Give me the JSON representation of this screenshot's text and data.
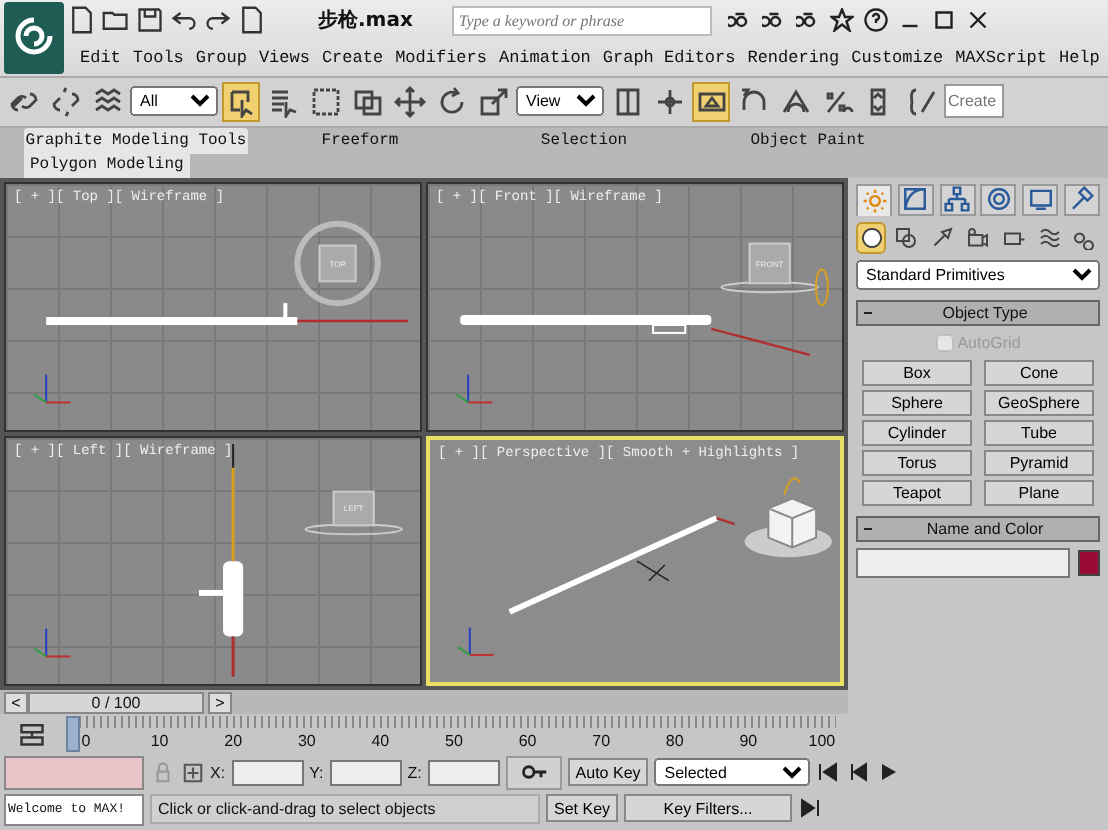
{
  "app": {
    "title": "步枪.max",
    "search": {
      "placeholder": "Type a keyword or phrase"
    }
  },
  "menu": [
    "Edit",
    "Tools",
    "Group",
    "Views",
    "Create",
    "Modifiers",
    "Animation",
    "Graph Editors",
    "Rendering",
    "Customize",
    "MAXScript",
    "Help"
  ],
  "toolbar": [
    {
      "kind": "link",
      "on": false
    },
    {
      "kind": "unlink",
      "on": false
    },
    {
      "kind": "bind",
      "on": false
    },
    {
      "kind": "dropdown",
      "value": "All"
    },
    {
      "kind": "select",
      "on": true
    },
    {
      "kind": "select-by-name",
      "on": false
    },
    {
      "kind": "region",
      "on": false
    },
    {
      "kind": "crossing",
      "on": false
    },
    {
      "kind": "move",
      "on": false
    },
    {
      "kind": "rotate",
      "on": false
    },
    {
      "kind": "scale",
      "on": false
    },
    {
      "kind": "dropdown",
      "value": "View"
    },
    {
      "kind": "pivot",
      "on": false
    },
    {
      "kind": "manipulate",
      "on": false
    },
    {
      "kind": "keyboard",
      "on": true
    },
    {
      "kind": "snap",
      "on": false
    },
    {
      "kind": "angle-snap",
      "on": false
    },
    {
      "kind": "percent-snap",
      "on": false
    },
    {
      "kind": "spinner-snap",
      "on": false
    },
    {
      "kind": "edit-sets",
      "on": false
    },
    {
      "kind": "field",
      "placeholder": "Create"
    }
  ],
  "ribbon": {
    "tabs": [
      {
        "label": "Graphite Modeling Tools",
        "selected": true
      },
      {
        "label": "Freeform",
        "selected": false
      },
      {
        "label": "Selection",
        "selected": false
      },
      {
        "label": "Object Paint",
        "selected": false
      }
    ],
    "panel": "Polygon Modeling"
  },
  "viewports": [
    {
      "kind": "top",
      "label": "[ + ][ Top ][ Wireframe ]",
      "cube": "TOP",
      "active": false
    },
    {
      "kind": "front",
      "label": "[ + ][ Front ][ Wireframe ]",
      "cube": "FRONT",
      "active": false
    },
    {
      "kind": "left",
      "label": "[ + ][ Left ][ Wireframe ]",
      "cube": "LEFT",
      "active": false
    },
    {
      "kind": "perspective",
      "label": "[ + ][ Perspective ][ Smooth + Highlights ]",
      "active": true
    }
  ],
  "command_panel": {
    "tabs": [
      {
        "kind": "create",
        "selected": true
      },
      {
        "kind": "modify",
        "selected": false
      },
      {
        "kind": "hierarchy",
        "selected": false
      },
      {
        "kind": "motion",
        "selected": false
      },
      {
        "kind": "display",
        "selected": false
      },
      {
        "kind": "utilities",
        "selected": false
      }
    ],
    "categories": [
      {
        "kind": "geometry",
        "selected": true
      },
      {
        "kind": "shapes",
        "selected": false
      },
      {
        "kind": "lights",
        "selected": false
      },
      {
        "kind": "cameras",
        "selected": false
      },
      {
        "kind": "helpers",
        "selected": false
      },
      {
        "kind": "spacewarps",
        "selected": false
      },
      {
        "kind": "systems",
        "selected": false
      }
    ],
    "type_dropdown": "Standard Primitives",
    "object_type": {
      "title": "Object Type",
      "autogrid": {
        "label": "AutoGrid",
        "checked": false,
        "disabled": true
      },
      "buttons": [
        "Box",
        "Cone",
        "Sphere",
        "GeoSphere",
        "Cylinder",
        "Tube",
        "Torus",
        "Pyramid",
        "Teapot",
        "Plane"
      ]
    },
    "name_and_color": {
      "title": "Name and Color",
      "color": "#9a0c36"
    }
  },
  "time_slider": {
    "prev": "<",
    "position": "0 / 100",
    "next": ">"
  },
  "trackbar": [
    "0",
    "10",
    "20",
    "30",
    "40",
    "50",
    "60",
    "70",
    "80",
    "90",
    "100"
  ],
  "status": {
    "listener": "Welcome to MAX!",
    "prompt": "Click or click-and-drag to select objects",
    "coords": [
      "X:",
      "Y:",
      "Z:"
    ],
    "auto_key": "Auto Key",
    "key_mode": "Selected",
    "set_key": "Set Key",
    "key_filters": "Key Filters..."
  }
}
